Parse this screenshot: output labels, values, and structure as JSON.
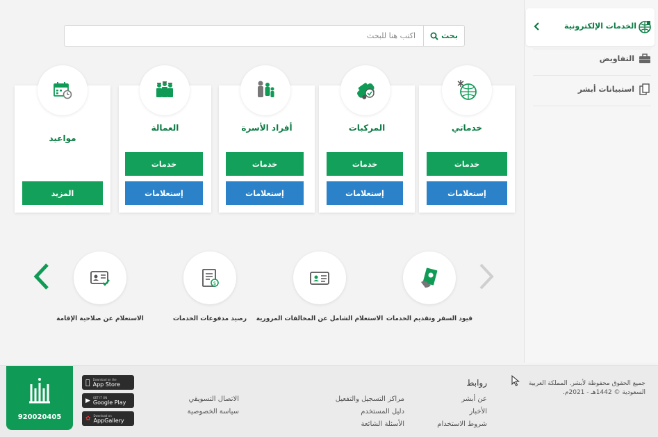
{
  "sidebar": {
    "active_label": "الخدمات الإلكترونية",
    "items": [
      {
        "label": "التفاويض",
        "icon": "briefcase-icon"
      },
      {
        "label": "استبيانات أبشر",
        "icon": "documents-icon"
      }
    ]
  },
  "search": {
    "button_label": "بحث",
    "placeholder": "اكتب هنا للبحث"
  },
  "cards": [
    {
      "title": "خدماتي",
      "icon": "globe-icon",
      "services_label": "خدمات",
      "inquiries_label": "إستعلامات"
    },
    {
      "title": "المركبات",
      "icon": "vehicle-icon",
      "services_label": "خدمات",
      "inquiries_label": "إستعلامات"
    },
    {
      "title": "أفراد الأسرة",
      "icon": "family-icon",
      "services_label": "خدمات",
      "inquiries_label": "إستعلامات"
    },
    {
      "title": "العمالة",
      "icon": "workers-icon",
      "services_label": "خدمات",
      "inquiries_label": "إستعلامات"
    },
    {
      "title": "مواعيد",
      "icon": "calendar-icon",
      "more_label": "المزيد"
    }
  ],
  "carousel": [
    {
      "label": "قيود السفر وتقديم الخدمات",
      "icon": "passport-icon"
    },
    {
      "label": "الاستعلام الشامل عن المخالفات المرورية",
      "icon": "id-card-icon"
    },
    {
      "label": "رصيد مدفوعات الخدمات",
      "icon": "receipt-icon"
    },
    {
      "label": "الاستعلام عن صلاحية الإقامة",
      "icon": "id-check-icon"
    }
  ],
  "footer": {
    "copyright": "جميع الحقوق محفوظة لأبشر. المملكة العربية السعودية © 1442هـ - 2021م.",
    "links_heading": "روابط",
    "links_col1": [
      "عن أبشر",
      "الأخبار",
      "شروط الاستخدام"
    ],
    "links_col2": [
      "مراكز التسجيل والتفعيل",
      "دليل المستخدم",
      "الأسئلة الشائعة"
    ],
    "links_col3": [
      "الاتصال التسويقي",
      "سياسة الخصوصية"
    ],
    "stores": [
      {
        "small": "Download on the",
        "big": "App Store"
      },
      {
        "small": "GET IT ON",
        "big": "Google Play"
      },
      {
        "small": "Download on",
        "big": "AppGallery"
      }
    ],
    "brand_number": "920020405"
  },
  "colors": {
    "primary_green": "#0b7b43",
    "button_green": "#12a05a",
    "button_blue": "#2b82c9"
  }
}
